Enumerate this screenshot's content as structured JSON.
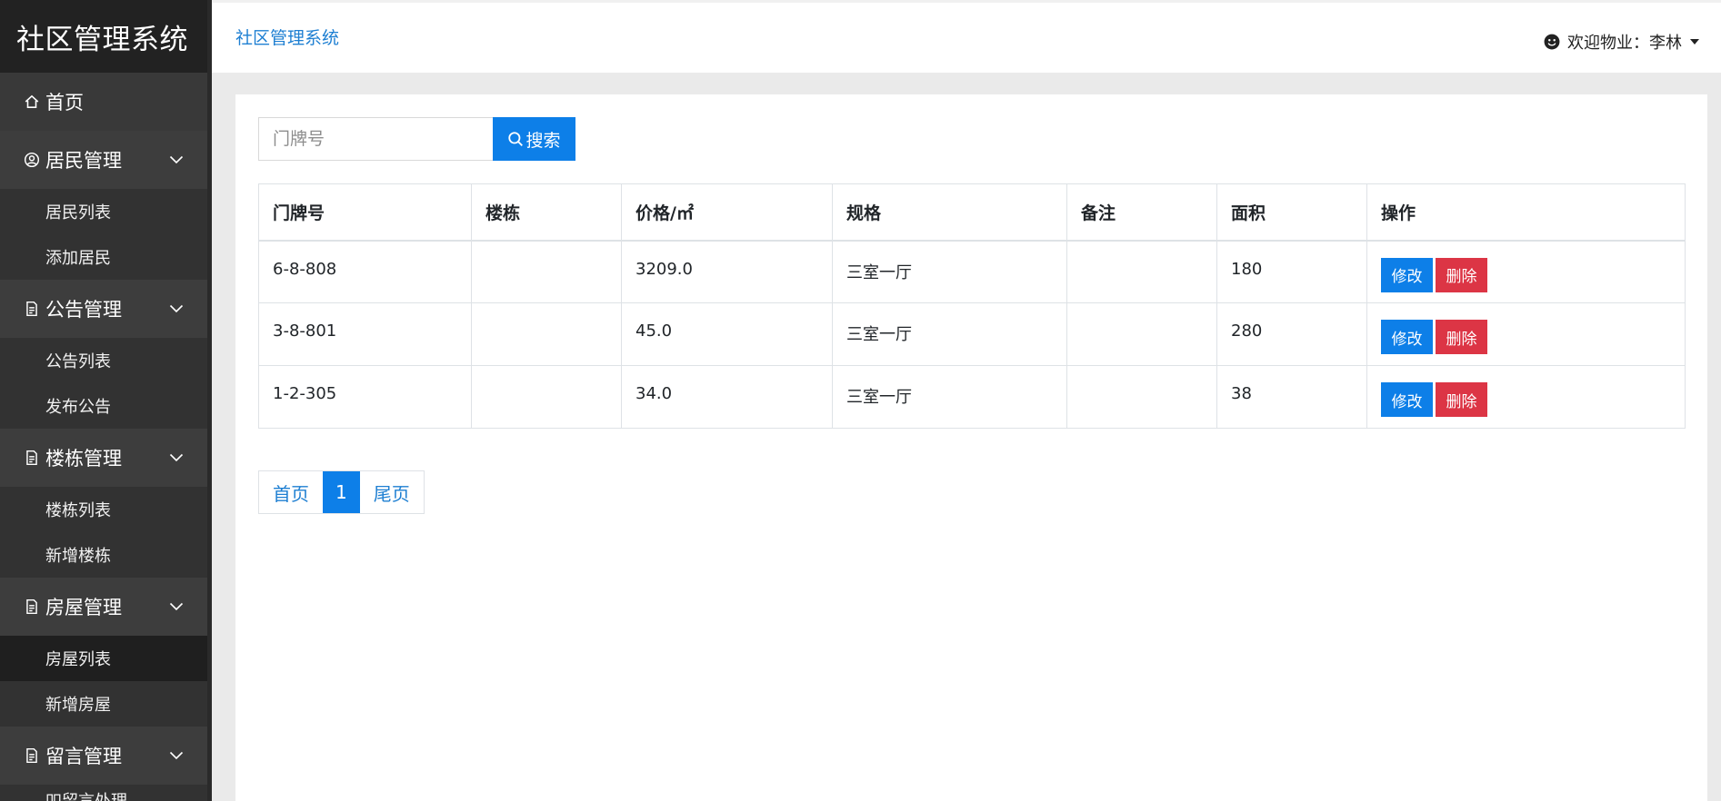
{
  "brand": "社区管理系统",
  "sidebar": {
    "home": "首页",
    "groups": [
      {
        "label": "居民管理",
        "items": [
          "居民列表",
          "添加居民"
        ]
      },
      {
        "label": "公告管理",
        "items": [
          "公告列表",
          "发布公告"
        ]
      },
      {
        "label": "楼栋管理",
        "items": [
          "楼栋列表",
          "新增楼栋"
        ]
      },
      {
        "label": "房屋管理",
        "items": [
          "房屋列表",
          "新增房屋"
        ]
      },
      {
        "label": "留言管理",
        "items": [
          "吅留言处理"
        ]
      }
    ],
    "active_item": "房屋列表"
  },
  "header": {
    "breadcrumb": "社区管理系统",
    "user_greeting": "欢迎物业：李林"
  },
  "search": {
    "placeholder": "门牌号",
    "button": "搜索"
  },
  "table": {
    "headers": [
      "门牌号",
      "楼栋",
      "价格/㎡",
      "规格",
      "备注",
      "面积",
      "操作"
    ],
    "rows": [
      [
        "6-8-808",
        "",
        "3209.0",
        "三室一厅",
        "",
        "180"
      ],
      [
        "3-8-801",
        "",
        "45.0",
        "三室一厅",
        "",
        "280"
      ],
      [
        "1-2-305",
        "",
        "34.0",
        "三室一厅",
        "",
        "38"
      ]
    ],
    "edit_label": "修改",
    "delete_label": "删除"
  },
  "pagination": {
    "first": "首页",
    "current": "1",
    "last": "尾页"
  },
  "colors": {
    "sidebar_bg": "#393939",
    "brand_bg": "#222222",
    "primary": "#0d7fe8",
    "danger": "#dc3545",
    "link": "#1e7fd2"
  }
}
